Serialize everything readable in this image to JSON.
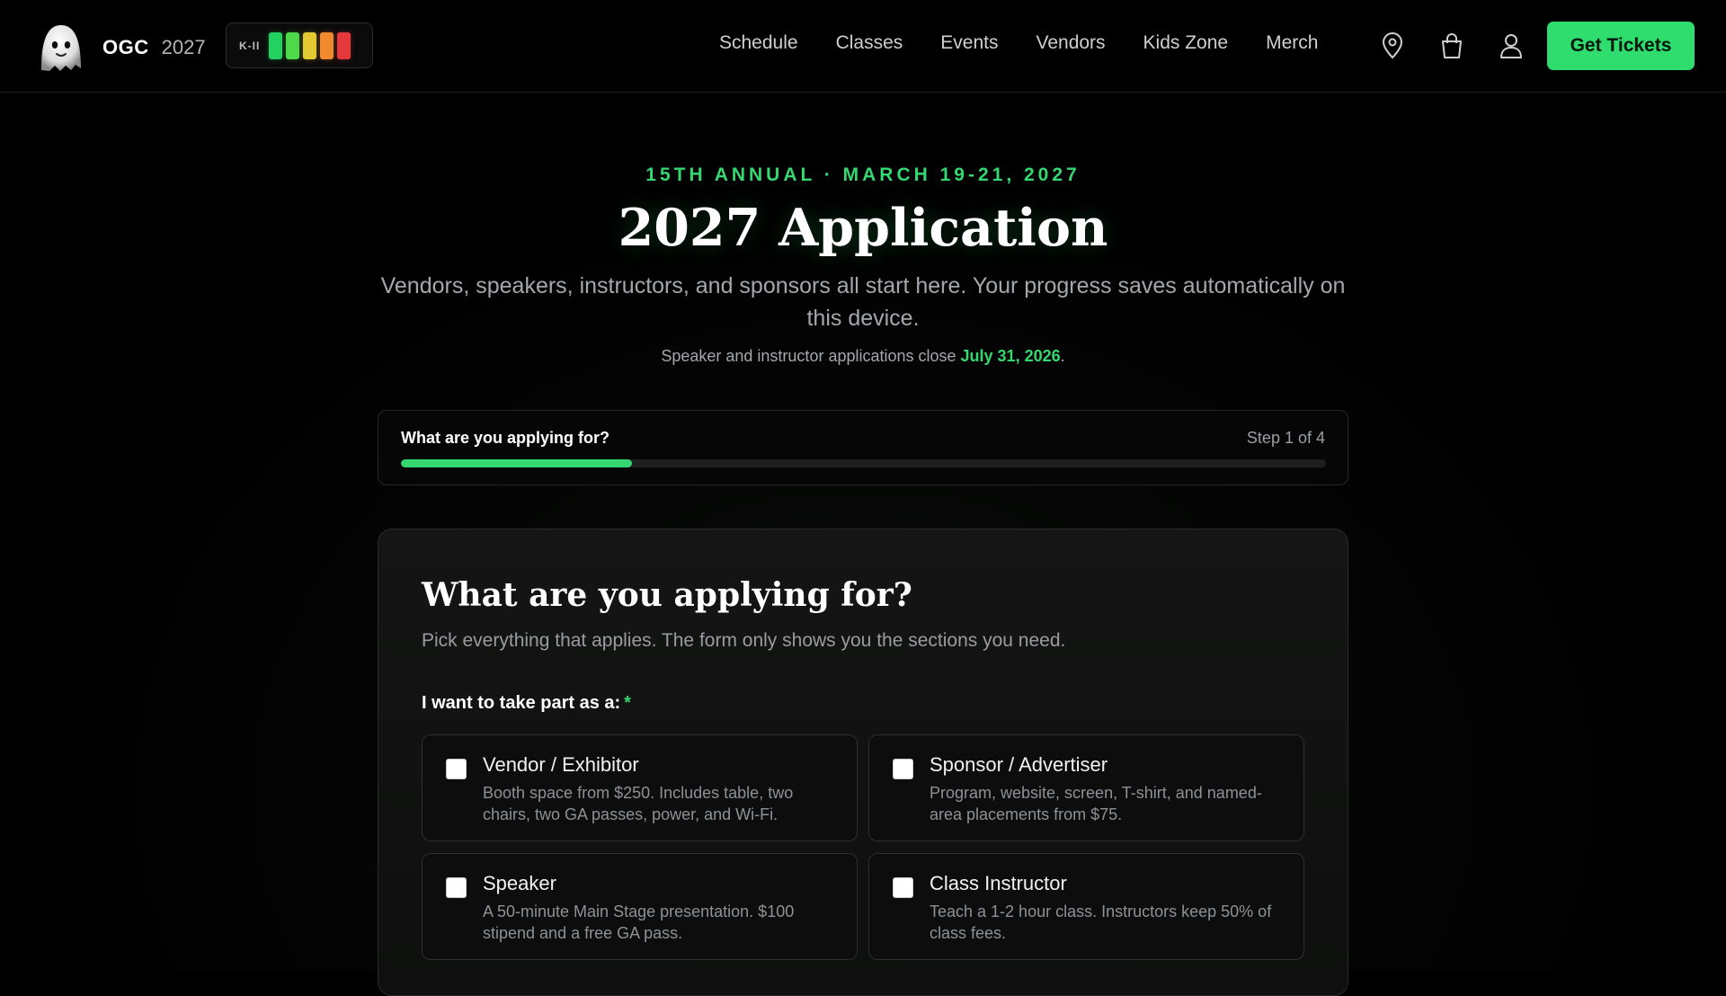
{
  "nav": {
    "brand": "OGC",
    "year": "2027",
    "meter_label": "K-II",
    "meter_bars": [
      "#23d160",
      "#4cd94a",
      "#e3c932",
      "#ef8a2e",
      "#e5383b"
    ],
    "links": [
      "Schedule",
      "Classes",
      "Events",
      "Vendors",
      "Kids Zone",
      "Merch"
    ],
    "icons": [
      "map-pin-icon",
      "shopping-bag-icon",
      "user-icon"
    ],
    "cta_label": "Get Tickets"
  },
  "hero": {
    "eyebrow": "15TH ANNUAL · MARCH 19-21, 2027",
    "title": "2027 Application",
    "subtitle": "Vendors, speakers, instructors, and sponsors all start here. Your progress saves automatically on this device.",
    "deadline_prefix": "Speaker and instructor applications close ",
    "deadline_date": "July 31, 2026",
    "deadline_suffix": "."
  },
  "progress": {
    "title": "What are you applying for?",
    "step_label": "Step 1 of 4",
    "fraction": 0.25
  },
  "form": {
    "title": "What are you applying for?",
    "description": "Pick everything that applies. The form only shows you the sections you need.",
    "label": "I want to take part as a:",
    "required_mark": "*",
    "options": [
      {
        "title": "Vendor / Exhibitor",
        "desc": "Booth space from $250. Includes table, two chairs, two GA passes, power, and Wi-Fi.",
        "checked": false
      },
      {
        "title": "Sponsor / Advertiser",
        "desc": "Program, website, screen, T-shirt, and named-area placements from $75.",
        "checked": false
      },
      {
        "title": "Speaker",
        "desc": "A 50-minute Main Stage presentation. $100 stipend and a free GA pass.",
        "checked": false
      },
      {
        "title": "Class Instructor",
        "desc": "Teach a 1-2 hour class. Instructors keep 50% of class fees.",
        "checked": false
      }
    ]
  },
  "colors": {
    "accent": "#35d870",
    "button": "#2fdc6e",
    "background": "#000000"
  }
}
